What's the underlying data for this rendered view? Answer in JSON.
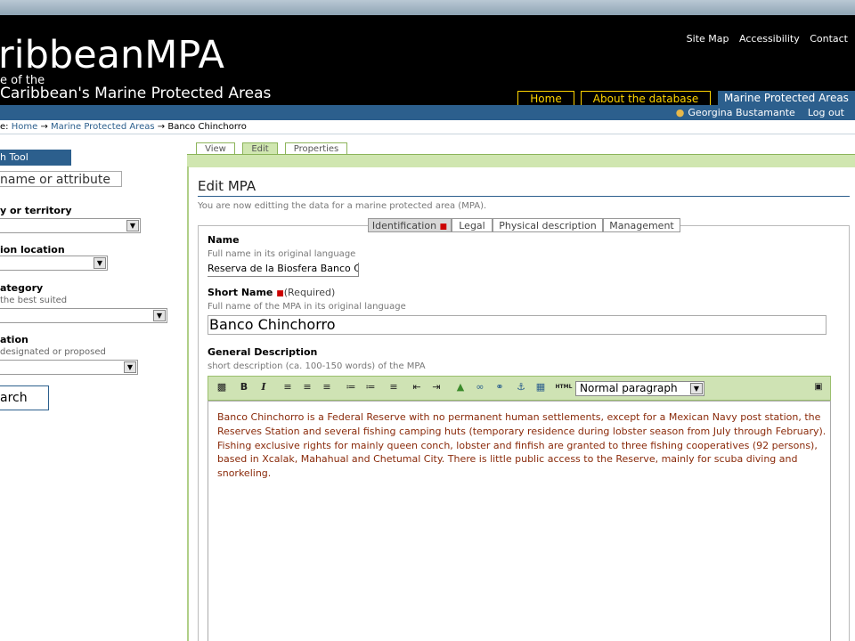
{
  "header": {
    "site_title": "ribbeanMPA",
    "subtitle_line1": "e of the",
    "subtitle_line2": "Caribbean's Marine Protected Areas",
    "links": [
      "Site Map",
      "Accessibility",
      "Contact"
    ]
  },
  "nav": {
    "tabs": [
      {
        "label": "Home",
        "state": "inactive"
      },
      {
        "label": "About the database",
        "state": "inactive"
      },
      {
        "label": "Marine Protected Areas",
        "state": "active"
      }
    ]
  },
  "user": {
    "name": "Georgina Bustamante",
    "logout": "Log out"
  },
  "breadcrumb": {
    "prefix": "e:",
    "items": [
      "Home",
      "→",
      "Marine Protected Areas",
      "→",
      "Banco Chinchorro"
    ]
  },
  "sidebar": {
    "title": "h Tool",
    "search_placeholder": "name or attribute",
    "filters": [
      {
        "label": "y or territory",
        "help": ""
      },
      {
        "label": "ion location",
        "help": ""
      },
      {
        "label": "ategory",
        "help": "the best suited"
      },
      {
        "label": "ation",
        "help": "designated or proposed"
      }
    ],
    "search_button": "arch"
  },
  "view_tabs": [
    "View",
    "Edit",
    "Properties"
  ],
  "page": {
    "title": "Edit MPA",
    "description": "You are now editting the data for a marine protected area (MPA)."
  },
  "form_tabs": [
    "Identification",
    "Legal",
    "Physical description",
    "Management"
  ],
  "fields": {
    "name": {
      "label": "Name",
      "help": "Full name in its original language",
      "value": "Reserva de la Biosfera Banco C"
    },
    "short_name": {
      "label": "Short Name",
      "required": "(Required)",
      "help": "Full name of the MPA in its original language",
      "value": "Banco Chinchorro"
    },
    "general_description": {
      "label": "General Description",
      "help": "short description (ca. 100-150 words) of the MPA"
    }
  },
  "editor": {
    "format_select": "Normal paragraph",
    "html_label": "HTML",
    "toolbar_icons": [
      "save-icon",
      "bold-icon",
      "italic-icon",
      "align-left-icon",
      "align-center-icon",
      "align-right-icon",
      "ordered-list-icon",
      "unordered-list-icon",
      "definition-list-icon",
      "outdent-icon",
      "indent-icon",
      "image-icon",
      "link-icon",
      "unlink-icon",
      "anchor-icon",
      "table-icon",
      "html-source-icon",
      "fullscreen-icon"
    ],
    "content": "Banco Chinchorro is a Federal Reserve with no permanent human settlements, except for a Mexican Navy post station, the Reserves Station  and several fishing camping huts (temporary residence during lobster season from July through February). Fishing exclusive rights for mainly queen conch, lobster and finfish are granted to three fishing cooperatives (92 persons), based in Xcalak, Mahahual and Chetumal City. There is little public access to the Reserve, mainly for scuba diving and snorkeling."
  },
  "colors": {
    "header_bg": "#000000",
    "nav_blue": "#2c5f8d",
    "nav_yellow": "#ffd400",
    "green_accent": "#d0e6b0",
    "editor_text": "#8a2a0a"
  }
}
